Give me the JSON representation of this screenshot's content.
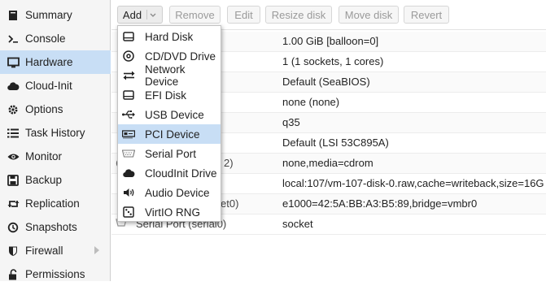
{
  "sidebar": {
    "items": [
      {
        "label": "Summary",
        "icon": "book-icon"
      },
      {
        "label": "Console",
        "icon": "terminal-icon"
      },
      {
        "label": "Hardware",
        "icon": "desktop-icon",
        "active": true
      },
      {
        "label": "Cloud-Init",
        "icon": "cloud-icon"
      },
      {
        "label": "Options",
        "icon": "gear-icon"
      },
      {
        "label": "Task History",
        "icon": "list-icon"
      },
      {
        "label": "Monitor",
        "icon": "eye-icon"
      },
      {
        "label": "Backup",
        "icon": "floppy-icon"
      },
      {
        "label": "Replication",
        "icon": "retweet-icon"
      },
      {
        "label": "Snapshots",
        "icon": "history-icon"
      },
      {
        "label": "Firewall",
        "icon": "shield-icon"
      },
      {
        "label": "Permissions",
        "icon": "unlock-icon"
      }
    ]
  },
  "toolbar": {
    "add": "Add",
    "remove": "Remove",
    "edit": "Edit",
    "resize": "Resize disk",
    "move": "Move disk",
    "revert": "Revert"
  },
  "hardware": {
    "rows": [
      {
        "name": "",
        "value": "1.00 GiB [balloon=0]"
      },
      {
        "name": "",
        "value": "1 (1 sockets, 1 cores)"
      },
      {
        "name": "",
        "value": "Default (SeaBIOS)"
      },
      {
        "name": "",
        "value": "none (none)"
      },
      {
        "name": "",
        "value": "q35"
      },
      {
        "name": "",
        "value": "Default (LSI 53C895A)"
      },
      {
        "name": "2)",
        "value": "none,media=cdrom"
      },
      {
        "name": "",
        "value": "local:107/vm-107-disk-0.raw,cache=writeback,size=16G"
      },
      {
        "name": "et0)",
        "value": "e1000=42:5A:BB:A3:B5:89,bridge=vmbr0"
      },
      {
        "name": "Serial Port (serial0)",
        "value": "socket"
      }
    ]
  },
  "add_menu": {
    "items": [
      {
        "label": "Hard Disk"
      },
      {
        "label": "CD/DVD Drive"
      },
      {
        "label": "Network Device"
      },
      {
        "label": "EFI Disk"
      },
      {
        "label": "USB Device"
      },
      {
        "label": "PCI Device",
        "active": true
      },
      {
        "label": "Serial Port"
      },
      {
        "label": "CloudInit Drive"
      },
      {
        "label": "Audio Device"
      },
      {
        "label": "VirtIO RNG"
      }
    ]
  },
  "colors": {
    "active_bg": "#c8def5",
    "sidebar_bg": "#f5f5f5"
  }
}
